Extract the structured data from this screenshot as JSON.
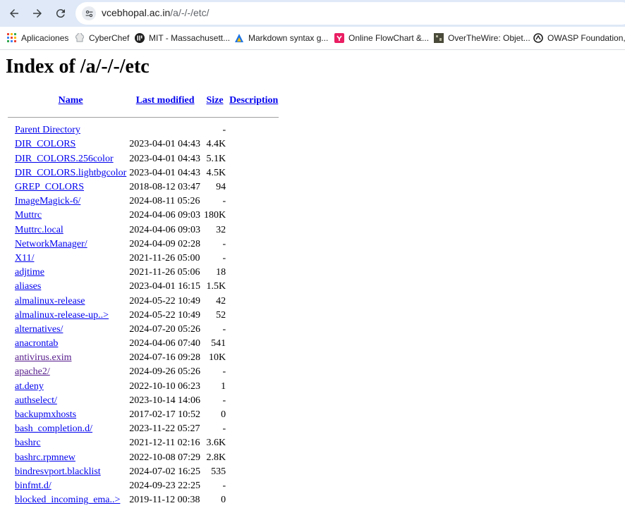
{
  "browser": {
    "url_host": "vcebhopal.ac.in",
    "url_path": "/a/-/-/etc/",
    "bookmarks": [
      {
        "label": "Aplicaciones",
        "icon": "apps-grid-icon"
      },
      {
        "label": "CyberChef",
        "icon": "chef-hat-icon"
      },
      {
        "label": "MIT - Massachusett...",
        "icon": "mit-logo-icon"
      },
      {
        "label": "Markdown syntax g...",
        "icon": "markdown-logo-icon"
      },
      {
        "label": "Online FlowChart &...",
        "icon": "flowchart-logo-icon"
      },
      {
        "label": "OverTheWire: Objet...",
        "icon": "overthewire-logo-icon"
      },
      {
        "label": "OWASP Foundation,...",
        "icon": "owasp-logo-icon"
      }
    ]
  },
  "page": {
    "title": "Index of /a/-/-/etc",
    "columns": {
      "name": "Name",
      "modified": "Last modified",
      "size": "Size",
      "description": "Description"
    },
    "rows": [
      {
        "name": "Parent Directory",
        "modified": "",
        "size": "-",
        "visited": false
      },
      {
        "name": "DIR_COLORS",
        "modified": "2023-04-01 04:43",
        "size": "4.4K",
        "visited": false
      },
      {
        "name": "DIR_COLORS.256color",
        "modified": "2023-04-01 04:43",
        "size": "5.1K",
        "visited": false
      },
      {
        "name": "DIR_COLORS.lightbgcolor",
        "modified": "2023-04-01 04:43",
        "size": "4.5K",
        "visited": false
      },
      {
        "name": "GREP_COLORS",
        "modified": "2018-08-12 03:47",
        "size": "94",
        "visited": false
      },
      {
        "name": "ImageMagick-6/",
        "modified": "2024-08-11 05:26",
        "size": "-",
        "visited": false
      },
      {
        "name": "Muttrc",
        "modified": "2024-04-06 09:03",
        "size": "180K",
        "visited": false
      },
      {
        "name": "Muttrc.local",
        "modified": "2024-04-06 09:03",
        "size": "32",
        "visited": false
      },
      {
        "name": "NetworkManager/",
        "modified": "2024-04-09 02:28",
        "size": "-",
        "visited": false
      },
      {
        "name": "X11/",
        "modified": "2021-11-26 05:00",
        "size": "-",
        "visited": false
      },
      {
        "name": "adjtime",
        "modified": "2021-11-26 05:06",
        "size": "18",
        "visited": false
      },
      {
        "name": "aliases",
        "modified": "2023-04-01 16:15",
        "size": "1.5K",
        "visited": false
      },
      {
        "name": "almalinux-release",
        "modified": "2024-05-22 10:49",
        "size": "42",
        "visited": false
      },
      {
        "name": "almalinux-release-up..>",
        "modified": "2024-05-22 10:49",
        "size": "52",
        "visited": false
      },
      {
        "name": "alternatives/",
        "modified": "2024-07-20 05:26",
        "size": "-",
        "visited": false
      },
      {
        "name": "anacrontab",
        "modified": "2024-04-06 07:40",
        "size": "541",
        "visited": false
      },
      {
        "name": "antivirus.exim",
        "modified": "2024-07-16 09:28",
        "size": "10K",
        "visited": true
      },
      {
        "name": "apache2/",
        "modified": "2024-09-26 05:26",
        "size": "-",
        "visited": true
      },
      {
        "name": "at.deny",
        "modified": "2022-10-10 06:23",
        "size": "1",
        "visited": false
      },
      {
        "name": "authselect/",
        "modified": "2023-10-14 14:06",
        "size": "-",
        "visited": false
      },
      {
        "name": "backupmxhosts",
        "modified": "2017-02-17 10:52",
        "size": "0",
        "visited": false
      },
      {
        "name": "bash_completion.d/",
        "modified": "2023-11-22 05:27",
        "size": "-",
        "visited": false
      },
      {
        "name": "bashrc",
        "modified": "2021-12-11 02:16",
        "size": "3.6K",
        "visited": false
      },
      {
        "name": "bashrc.rpmnew",
        "modified": "2022-10-08 07:29",
        "size": "2.8K",
        "visited": false
      },
      {
        "name": "bindresvport.blacklist",
        "modified": "2024-07-02 16:25",
        "size": "535",
        "visited": false
      },
      {
        "name": "binfmt.d/",
        "modified": "2024-09-23 22:25",
        "size": "-",
        "visited": false
      },
      {
        "name": "blocked_incoming_ema..>",
        "modified": "2019-11-12 00:38",
        "size": "0",
        "visited": false
      }
    ]
  }
}
